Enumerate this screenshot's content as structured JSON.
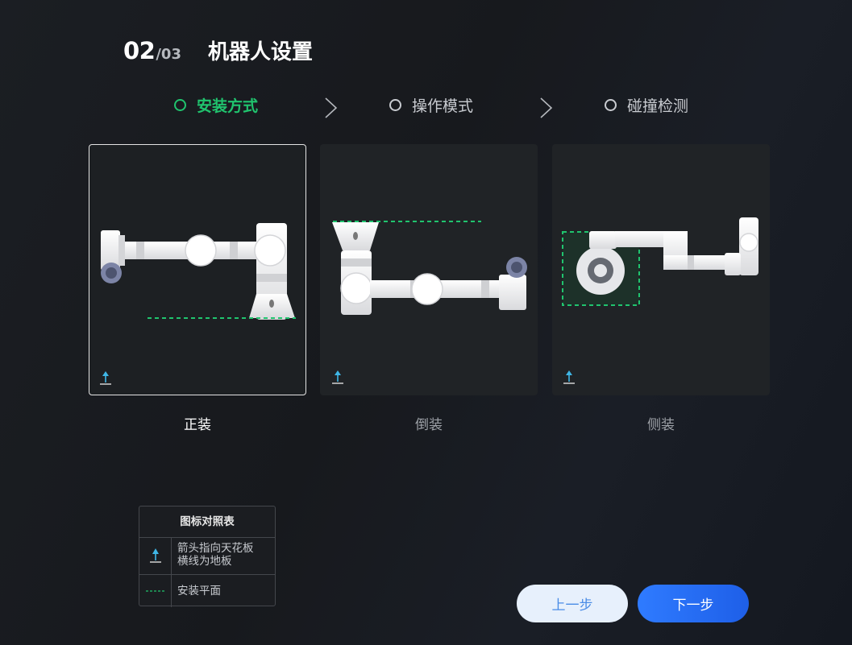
{
  "header": {
    "step_current": "02",
    "step_total": "/03",
    "title": "机器人设置"
  },
  "steps": [
    {
      "label": "安装方式",
      "state": "active"
    },
    {
      "label": "操作模式",
      "state": "inactive"
    },
    {
      "label": "碰撞检测",
      "state": "inactive"
    }
  ],
  "cards": [
    {
      "label": "正装",
      "selected": true,
      "icon": "arrow-up-floor-icon"
    },
    {
      "label": "倒装",
      "selected": false,
      "icon": "arrow-up-floor-icon"
    },
    {
      "label": "侧装",
      "selected": false,
      "icon": "arrow-up-floor-icon"
    }
  ],
  "legend": {
    "title": "图标对照表",
    "rows": [
      {
        "icon": "arrow-up-floor-icon",
        "text_line1": "箭头指向天花板",
        "text_line2": "横线为地板"
      },
      {
        "icon": "dashed-line-icon",
        "text_line1": "安装平面"
      }
    ]
  },
  "buttons": {
    "prev_label": "上一步",
    "next_label": "下一步"
  },
  "colors": {
    "accent_green": "#20c46e",
    "primary_blue": "#2f7bff",
    "arrow_cyan": "#3fb6e6"
  }
}
